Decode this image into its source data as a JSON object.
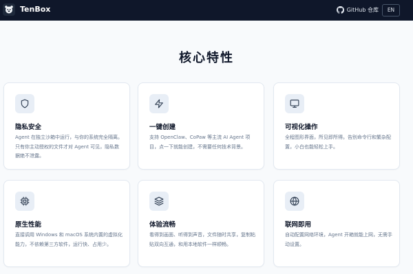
{
  "header": {
    "brand": "TenBox",
    "github_label": "GitHub 仓库",
    "lang_label": "EN"
  },
  "section": {
    "title": "核心特性"
  },
  "features": [
    {
      "icon": "shield-icon",
      "title": "隐私安全",
      "desc": "Agent 在独立沙箱中运行，与你的系统完全隔离。只有你主动授权的文件才对 Agent 可见，隐私数据绝不泄露。"
    },
    {
      "icon": "bolt-icon",
      "title": "一键创建",
      "desc": "支持 OpenClaw、CoPaw 等主流 AI Agent 项目，点一下就能创建，不需要任何技术背景。"
    },
    {
      "icon": "monitor-icon",
      "title": "可视化操作",
      "desc": "全程图形界面，所见即所得。告别命令行和繁杂配置，小白也能轻松上手。"
    },
    {
      "icon": "chip-icon",
      "title": "原生性能",
      "desc": "直接调用 Windows 和 macOS 系统内置的虚拟化能力，不依赖第三方软件，运行快、占用少。"
    },
    {
      "icon": "layers-icon",
      "title": "体验流畅",
      "desc": "看得到画面、听得到声音，文件随时共享，复制粘贴双向互通，和用本地软件一样顺畅。"
    },
    {
      "icon": "globe-icon",
      "title": "联网即用",
      "desc": "自动配置网络环境，Agent 开箱就能上网，无需手动设置。"
    }
  ]
}
